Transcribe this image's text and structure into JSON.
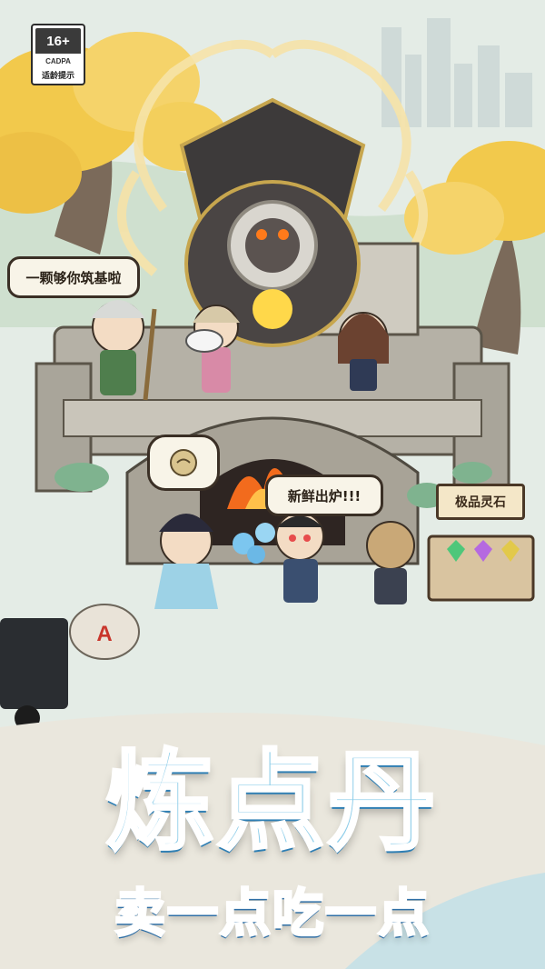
{
  "rating": {
    "age": "16+",
    "org": "CADPA",
    "hint": "适龄提示"
  },
  "bubbles": {
    "npc_left": "一颗够你筑基啦",
    "npc_center": "新鲜出炉!!!"
  },
  "sign": {
    "label": "极品灵石"
  },
  "banner": {
    "title": "炼点丹",
    "subtitle": "卖一点吃一点"
  },
  "colors": {
    "title_fill": "#8ecde9",
    "title_shadow": "#2f7fb4",
    "tree_gold": "#f2c94c",
    "stone": "#a9a59a",
    "furnace": "#3d3a3a",
    "fire": "#f26b1d"
  }
}
